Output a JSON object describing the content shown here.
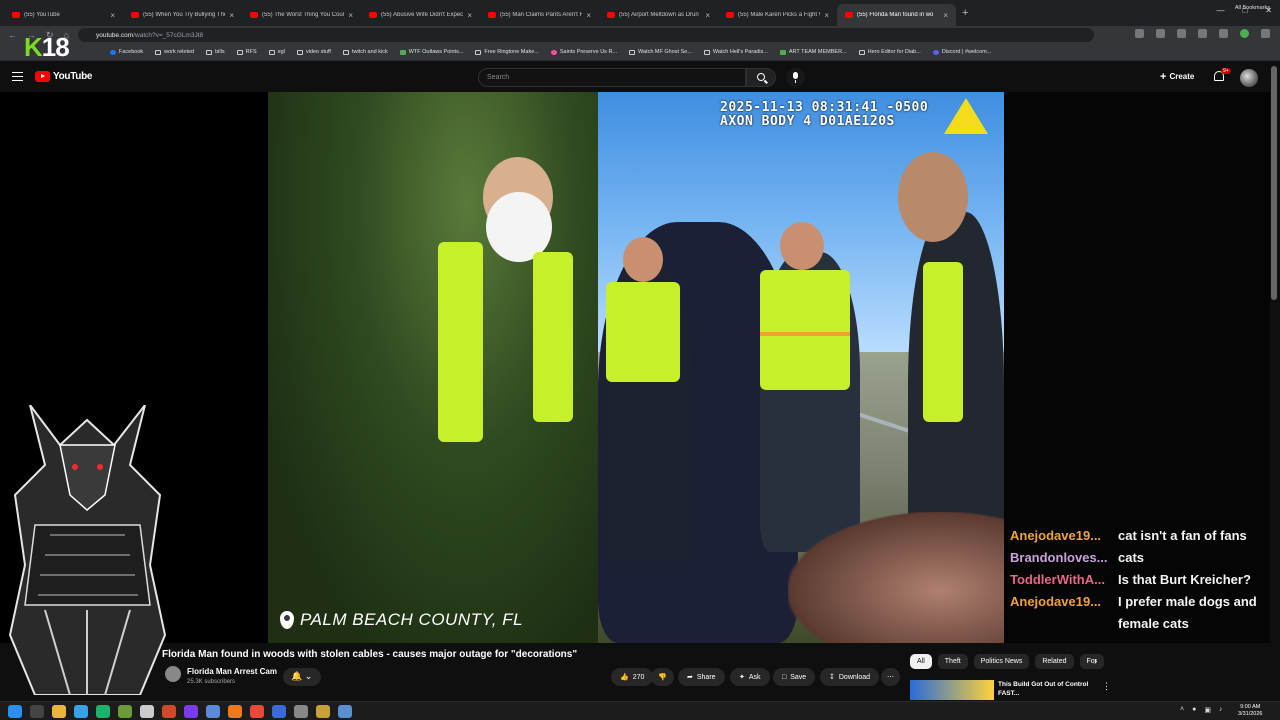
{
  "browser": {
    "tabs": [
      {
        "title": "(55) YouTube"
      },
      {
        "title": "(55) When You Try Bullying The"
      },
      {
        "title": "(55) The Worst Thing You Could"
      },
      {
        "title": "(55) Abusive Wife Didn't Expec"
      },
      {
        "title": "(55) Man Claims Pants Aren't H"
      },
      {
        "title": "(55) Airport Meltdown as Drun"
      },
      {
        "title": "(55) Male Karen Picks a Fight W"
      },
      {
        "title": "(55) Florida Man found in wo"
      }
    ],
    "active_tab_index": 7,
    "new_tab_glyph": "+",
    "url_host": "youtube.com",
    "url_rest": "/watch?v=_57cGLm3Jt8",
    "profile_letter": "L",
    "bookmarks": [
      {
        "label": "Facebook",
        "icon": "facebook-icon"
      },
      {
        "label": "work releted",
        "icon": "folder-icon"
      },
      {
        "label": "bills",
        "icon": "folder-icon"
      },
      {
        "label": "RFS",
        "icon": "folder-icon"
      },
      {
        "label": "egl",
        "icon": "folder-icon"
      },
      {
        "label": "video stuff",
        "icon": "folder-icon"
      },
      {
        "label": "twitch and kick",
        "icon": "folder-icon"
      },
      {
        "label": "WTF Outlaws Points...",
        "icon": "green-square-icon"
      },
      {
        "label": "Free Ringtone Make...",
        "icon": "page-icon"
      },
      {
        "label": "Saints Preserve Us R...",
        "icon": "pink-icon"
      },
      {
        "label": "Watch MF Ghost Se...",
        "icon": "page-icon"
      },
      {
        "label": "Watch Hell's Paradis...",
        "icon": "page-icon"
      },
      {
        "label": "ART TEAM MEMBER...",
        "icon": "green-square-icon"
      },
      {
        "label": "Hero Editor for Diab...",
        "icon": "page-icon"
      },
      {
        "label": "Discord | #welcom...",
        "icon": "discord-icon"
      }
    ],
    "all_bookmarks": "All Bookmarks"
  },
  "overlay": {
    "k": "K",
    "num": "18"
  },
  "youtube": {
    "search_placeholder": "Search",
    "create_label": "Create",
    "notification_count": "9+",
    "logo_text": "YouTube"
  },
  "video": {
    "timestamp_line1": "2025-11-13 08:31:41 -0500",
    "timestamp_line2": "AXON BODY 4 D01AE120S",
    "location": "PALM BEACH COUNTY, FL",
    "title": "Florida Man found in woods with stolen cables - causes major outage for \"decorations\"",
    "channel": "Florida Man Arrest Cam",
    "subscribers": "25.3K subscribers",
    "likes": "270",
    "actions": {
      "share": "Share",
      "ask": "Ask",
      "save": "Save",
      "download": "Download"
    }
  },
  "chat": [
    {
      "user": "Anejodave19...",
      "message": "cat isn't a fan of fans",
      "color": "#f0a23a"
    },
    {
      "user": "Brandonloves...",
      "message": "cats",
      "color": "#c9a0dc"
    },
    {
      "user": "ToddlerWithA...",
      "message": "Is that Burt Kreicher?",
      "color": "#e8668a"
    },
    {
      "user": "Anejodave19...",
      "message": "I prefer male dogs and female cats",
      "color": "#f0a23a"
    }
  ],
  "chips": [
    "All",
    "Theft",
    "Politics News",
    "Related",
    "For"
  ],
  "recommended": {
    "title": "This Build Got Out of Control FAST..."
  },
  "taskbar": {
    "time": "9:00 AM",
    "date": "3/31/2026"
  },
  "colors": {
    "yt_red": "#ff0000",
    "vest": "#c6f02a",
    "axon_yellow": "#f4dc1a"
  }
}
